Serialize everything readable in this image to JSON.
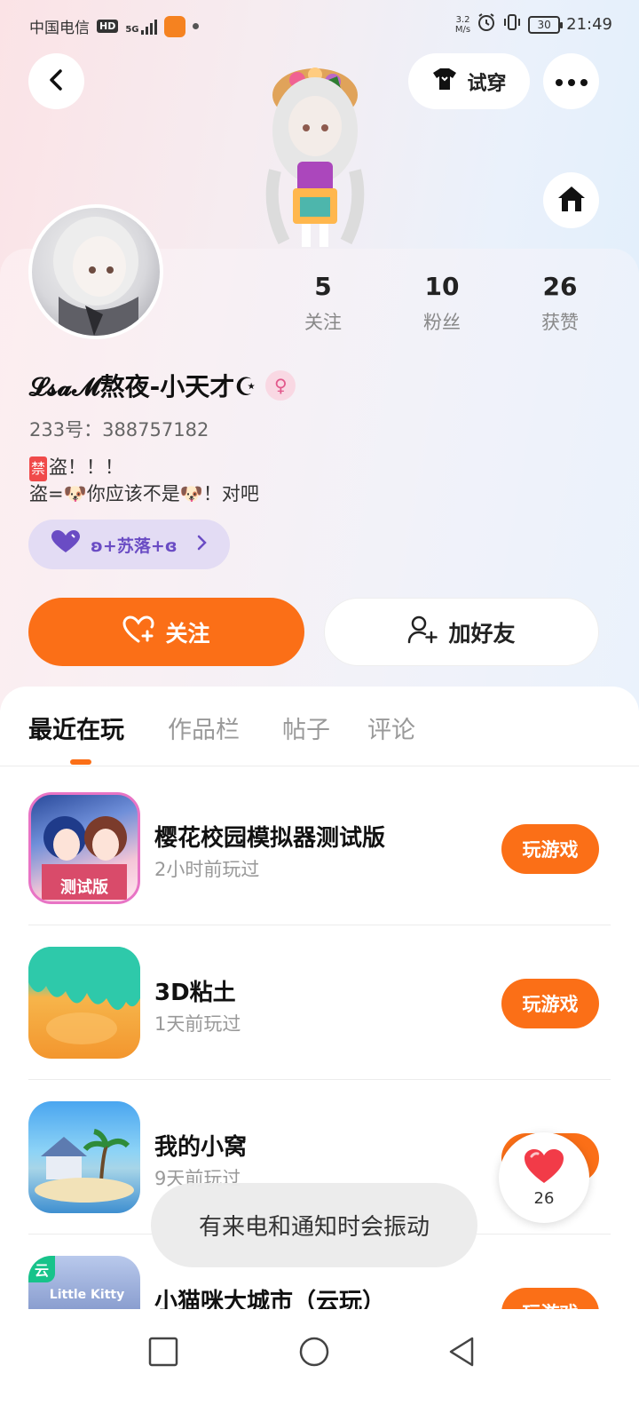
{
  "status_bar": {
    "carrier": "中国电信",
    "network_hd": "HD",
    "network_5g": "5G",
    "speed_value": "3.2",
    "speed_unit": "M/s",
    "battery": "30",
    "time": "21:49"
  },
  "header": {
    "tryon_label": "试穿"
  },
  "profile": {
    "stats": [
      {
        "value": "5",
        "label": "关注"
      },
      {
        "value": "10",
        "label": "粉丝"
      },
      {
        "value": "26",
        "label": "获赞"
      }
    ],
    "name": "𝓛𝓼𝓪𝓜熬夜-小天才☪",
    "gender_symbol": "♀",
    "uid": "233号：388757182",
    "bio_tag": "禁",
    "bio_line1": "盗！！！",
    "bio_line2": "盗=🐶你应该不是🐶！对吧",
    "family_label": "ʚ+苏落+ɞ",
    "follow_label": "关注",
    "add_friend_label": "加好友"
  },
  "tabs": [
    {
      "label": "最近在玩",
      "active": true
    },
    {
      "label": "作品栏",
      "active": false
    },
    {
      "label": "帖子",
      "active": false
    },
    {
      "label": "评论",
      "active": false
    }
  ],
  "games": [
    {
      "name": "樱花校园模拟器测试版",
      "time": "2小时前玩过",
      "button": "玩游戏",
      "icon": "sakura-school-game-icon",
      "icon_text": "测试版"
    },
    {
      "name": "3D粘土",
      "time": "1天前玩过",
      "button": "玩游戏",
      "icon": "3d-clay-game-icon"
    },
    {
      "name": "我的小窝",
      "time": "9天前玩过",
      "button": "玩游戏",
      "icon": "my-nest-game-icon"
    },
    {
      "name": "小猫咪大城市（云玩）",
      "time": "",
      "button": "玩游戏",
      "icon": "little-kitty-game-icon",
      "cloud_tag": "云",
      "icon_text": "Little Kitty"
    }
  ],
  "floating_like": {
    "count": "26"
  },
  "toast": {
    "message": "有来电和通知时会振动"
  },
  "colors": {
    "accent": "#fb6f17",
    "purple": "#6a4cc4",
    "cloud_green": "#17c38a"
  }
}
